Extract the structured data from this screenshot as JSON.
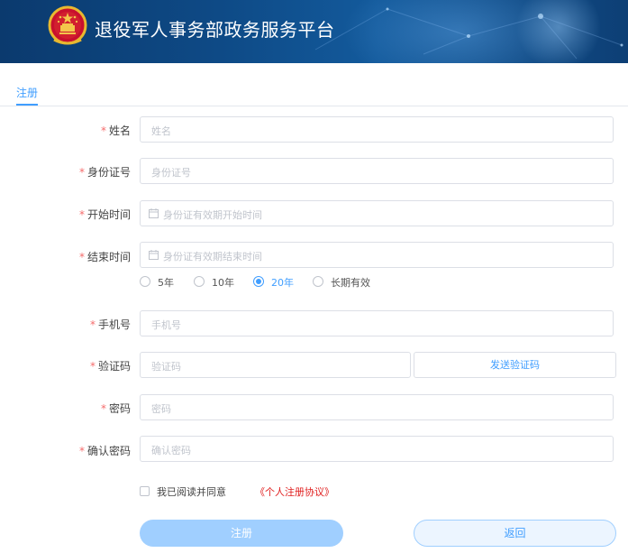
{
  "header": {
    "title": "退役军人事务部政务服务平台",
    "emblem_icon": "national-emblem"
  },
  "tabs": [
    {
      "label": "注册",
      "active": true
    }
  ],
  "form": {
    "required_mark": "*",
    "name": {
      "label": "姓名",
      "placeholder": "姓名"
    },
    "id_number": {
      "label": "身份证号",
      "placeholder": "身份证号"
    },
    "start_time": {
      "label": "开始时间",
      "placeholder": "身份证有效期开始时间",
      "icon": "calendar-icon"
    },
    "end_time": {
      "label": "结束时间",
      "placeholder": "身份证有效期结束时间",
      "icon": "calendar-icon"
    },
    "validity_options": [
      {
        "label": "5年",
        "selected": false
      },
      {
        "label": "10年",
        "selected": false
      },
      {
        "label": "20年",
        "selected": true
      },
      {
        "label": "长期有效",
        "selected": false
      }
    ],
    "phone": {
      "label": "手机号",
      "placeholder": "手机号"
    },
    "verify_code": {
      "label": "验证码",
      "placeholder": "验证码",
      "send_button": "发送验证码"
    },
    "password": {
      "label": "密码",
      "placeholder": "密码"
    },
    "confirm_password": {
      "label": "确认密码",
      "placeholder": "确认密码"
    },
    "agreement": {
      "text": "我已阅读并同意",
      "link": "《个人注册协议》",
      "checked": false
    },
    "register_button": "注册",
    "back_button": "返回"
  },
  "colors": {
    "primary": "#409eff",
    "required": "#f56c6c",
    "agreement_link": "#e02020",
    "header_bg": "#0e4a86"
  }
}
